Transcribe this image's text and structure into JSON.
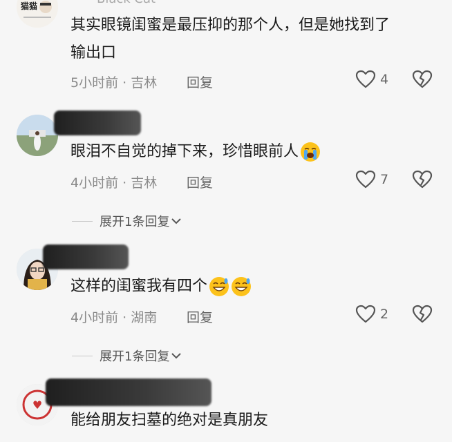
{
  "comments": [
    {
      "username": "Black Cat",
      "text_line1": "其实眼镜闺蜜是最压抑的那个人，但是她找到了",
      "text_line2": "输出口",
      "time_location": "5小时前 · 吉林",
      "reply_label": "回复",
      "likes": "4"
    },
    {
      "text": "眼泪不自觉的掉下来，珍惜眼前人",
      "time_location": "4小时前 · 吉林",
      "reply_label": "回复",
      "likes": "7",
      "expand_label": "展开1条回复"
    },
    {
      "text": "这样的闺蜜我有四个",
      "time_location": "4小时前 · 湖南",
      "reply_label": "回复",
      "likes": "2",
      "expand_label": "展开1条回复"
    },
    {
      "text": "能给朋友扫墓的绝对是真朋友"
    }
  ],
  "avatar1_text": "猫猫",
  "icons": {
    "like": "heart-outline-icon",
    "dislike": "broken-heart-icon",
    "expand": "chevron-down-icon",
    "cry_emoji": "loudly-crying-face-icon",
    "grin_sweat_emoji": "grinning-sweat-face-icon"
  }
}
